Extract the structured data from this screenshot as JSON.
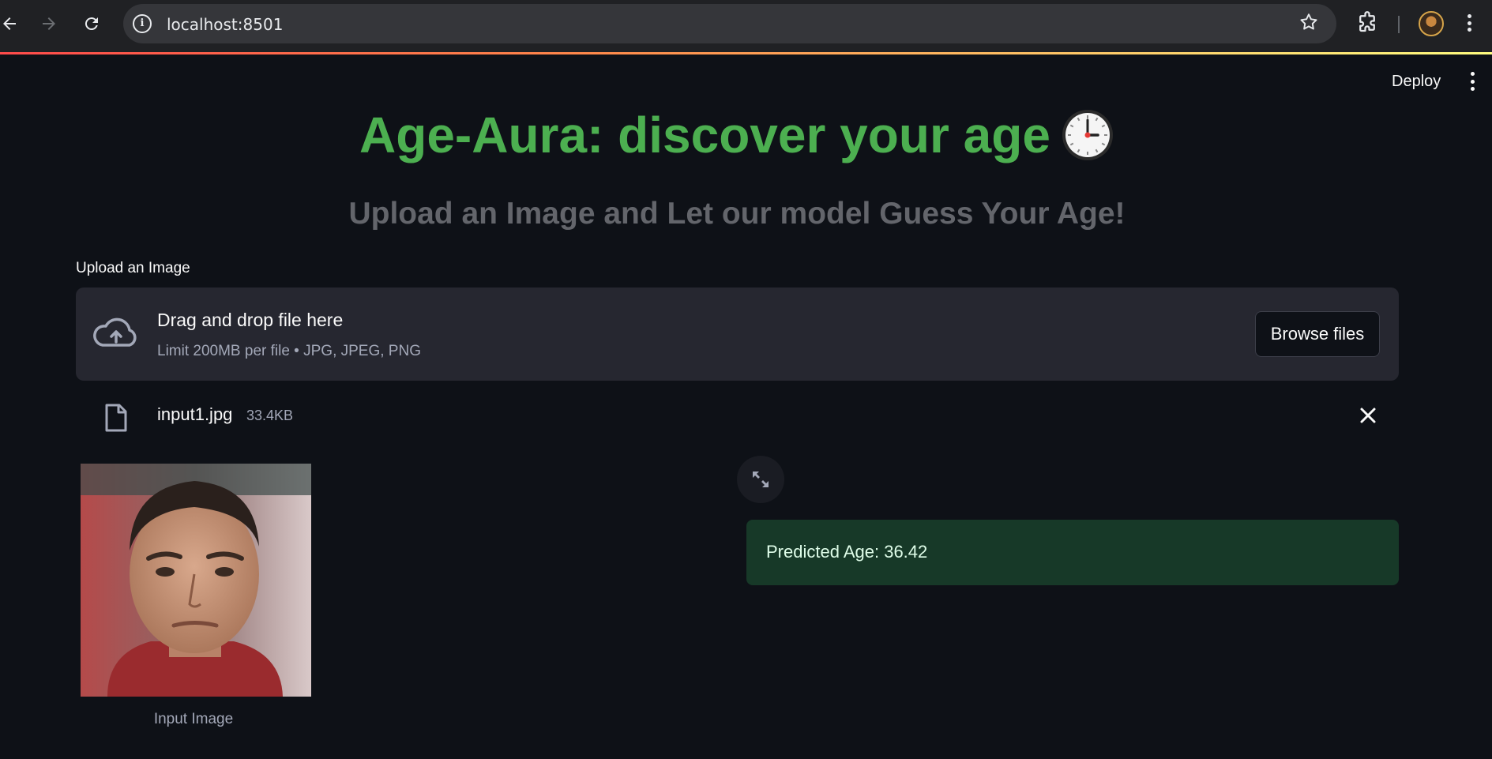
{
  "browser": {
    "url": "localhost:8501"
  },
  "header": {
    "deploy_label": "Deploy"
  },
  "main": {
    "title": "Age-Aura: discover your age",
    "subtitle": "Upload an Image and Let our model Guess Your Age!",
    "upload": {
      "label": "Upload an Image",
      "drop_text": "Drag and drop file here",
      "limit_text": "Limit 200MB per file • JPG, JPEG, PNG",
      "browse_label": "Browse files"
    },
    "uploaded_file": {
      "name": "input1.jpg",
      "size": "33.4KB"
    },
    "image_caption": "Input Image",
    "result_text": "Predicted Age: 36.42"
  },
  "colors": {
    "title": "#4caf50",
    "background": "#0e1117",
    "result_bg": "#173928",
    "dropzone_bg": "#262730"
  }
}
